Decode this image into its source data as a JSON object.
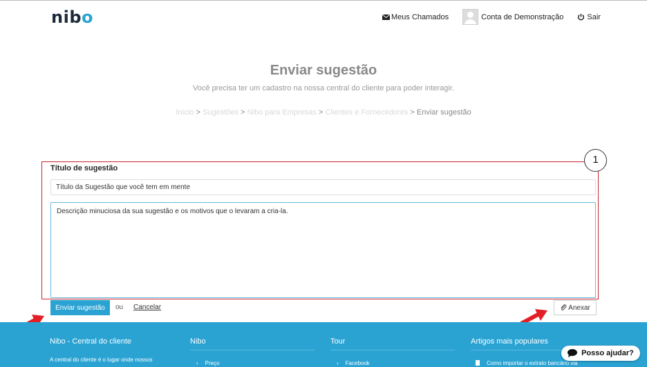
{
  "brand": {
    "logo_text": "nib",
    "logo_o": "o",
    "accent": "#2aa3d3",
    "dark": "#1e2a3a"
  },
  "nav": {
    "my_tickets": "Meus Chamados",
    "account": "Conta de Demonstração",
    "logout": "Sair",
    "icons": [
      "envelope-icon",
      "avatar",
      "power-icon"
    ]
  },
  "header": {
    "title": "Enviar sugestão",
    "subtitle": "Você precisa ter um cadastro na nossa central do cliente para poder interagir."
  },
  "breadcrumb": {
    "items": [
      "Início",
      "Sugestões",
      "Nibo para Empresas",
      "Clientes e Fornecedores"
    ],
    "current": "Enviar sugestão",
    "separator": ">"
  },
  "form": {
    "annotation_number": "1",
    "title_label": "Título de sugestão",
    "title_value": "Título da Sugestão que você tem em mente",
    "description_value": "Descrição minuciosa da sua sugestão e os motivos que o levaram a cria-la.",
    "submit_label": "Enviar sugestão",
    "or_label": "ou",
    "cancel_label": "Cancelar",
    "attach_label": "Anexar",
    "highlight_color": "#c9242b",
    "arrow_color": "#e31e24"
  },
  "footer": {
    "columns": [
      {
        "heading": "Nibo - Central do cliente",
        "item": "A central do cliente é o lugar onde nossos"
      },
      {
        "heading": "Nibo",
        "item": "Preço"
      },
      {
        "heading": "Tour",
        "item": "Facebook"
      },
      {
        "heading": "Artigos mais populares",
        "item": "Como importar o extrato bancário via"
      }
    ]
  },
  "help_widget": {
    "label": "Posso ajudar?"
  }
}
